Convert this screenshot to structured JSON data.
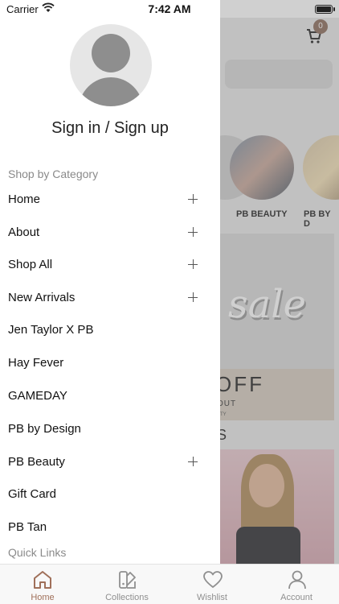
{
  "status_bar": {
    "carrier": "Carrier",
    "time": "7:42 AM"
  },
  "background": {
    "cart_count": "0",
    "categories": [
      "PB BEAUTY",
      "PB BY D"
    ],
    "banner": {
      "sale_text": "sale",
      "off_text": "OFF",
      "sub_text": "OUT",
      "small_text": "TY"
    },
    "section_letter": "S"
  },
  "drawer": {
    "sign_in": "Sign in / Sign up",
    "shop_section": "Shop by Category",
    "items": [
      {
        "label": "Home"
      },
      {
        "label": "About"
      },
      {
        "label": "Shop All"
      },
      {
        "label": "New Arrivals"
      },
      {
        "label": "Jen Taylor X PB"
      },
      {
        "label": "Hay Fever"
      },
      {
        "label": "GAMEDAY"
      },
      {
        "label": "PB by Design"
      },
      {
        "label": "PB Beauty"
      },
      {
        "label": "Gift Card"
      },
      {
        "label": "PB Tan"
      }
    ],
    "quick_links": "Quick Links"
  },
  "tabbar": {
    "tabs": [
      {
        "label": "Home",
        "icon": "home-icon"
      },
      {
        "label": "Collections",
        "icon": "collections-icon"
      },
      {
        "label": "Wishlist",
        "icon": "heart-icon"
      },
      {
        "label": "Account",
        "icon": "account-icon"
      }
    ],
    "active": "Home"
  },
  "colors": {
    "accent": "#a0705a",
    "inactive": "#8f8f8f"
  }
}
